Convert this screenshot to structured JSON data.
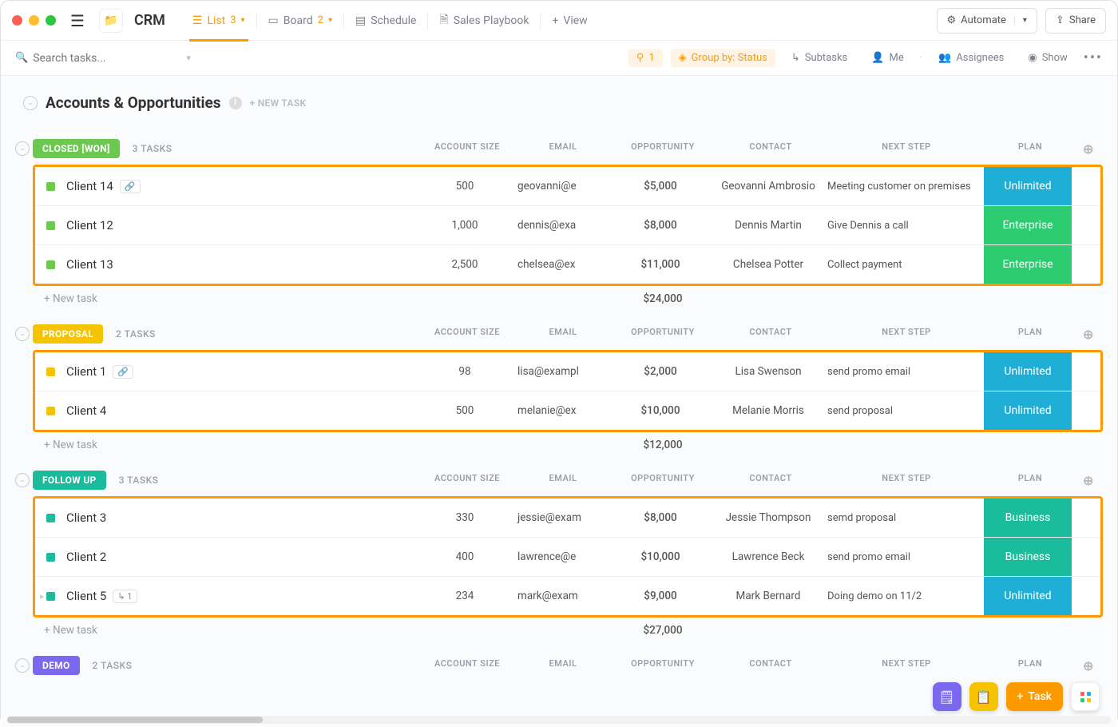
{
  "app": {
    "title": "CRM"
  },
  "views": {
    "list": {
      "label": "List",
      "count": "3"
    },
    "board": {
      "label": "Board",
      "count": "2"
    },
    "schedule": {
      "label": "Schedule"
    },
    "playbook": {
      "label": "Sales Playbook"
    },
    "add": {
      "label": "View"
    }
  },
  "topbar": {
    "automate": "Automate",
    "share": "Share"
  },
  "filters": {
    "search_placeholder": "Search tasks...",
    "filter_count": "1",
    "group_by": "Group by: Status",
    "subtasks": "Subtasks",
    "me": "Me",
    "assignees": "Assignees",
    "show": "Show"
  },
  "list": {
    "title": "Accounts & Opportunities",
    "new_task_header": "+ NEW TASK",
    "new_task_row": "+ New task",
    "columns": {
      "account_size": "ACCOUNT SIZE",
      "email": "EMAIL",
      "opportunity": "OPPORTUNITY",
      "contact": "CONTACT",
      "next_step": "NEXT STEP",
      "plan": "PLAN"
    }
  },
  "groups": [
    {
      "id": "closed-won",
      "label": "CLOSED [WON]",
      "pill_class": "pill-green",
      "sq_class": "sq-green",
      "task_count": "3 TASKS",
      "sum": "$24,000",
      "rows": [
        {
          "name": "Client 14",
          "link": true,
          "acct": "500",
          "email": "geovanni@e",
          "opp": "$5,000",
          "contact": "Geovanni Ambrosio",
          "next": "Meeting customer on premises",
          "plan": "Unlimited",
          "plan_class": "plan-unlimited"
        },
        {
          "name": "Client 12",
          "acct": "1,000",
          "email": "dennis@exa",
          "opp": "$8,000",
          "contact": "Dennis Martin",
          "next": "Give Dennis a call",
          "plan": "Enterprise",
          "plan_class": "plan-enterprise"
        },
        {
          "name": "Client 13",
          "acct": "2,500",
          "email": "chelsea@ex",
          "opp": "$11,000",
          "contact": "Chelsea Potter",
          "next": "Collect payment",
          "plan": "Enterprise",
          "plan_class": "plan-enterprise"
        }
      ]
    },
    {
      "id": "proposal",
      "label": "PROPOSAL",
      "pill_class": "pill-yellow",
      "sq_class": "sq-yellow",
      "task_count": "2 TASKS",
      "sum": "$12,000",
      "rows": [
        {
          "name": "Client 1",
          "link": true,
          "acct": "98",
          "email": "lisa@exampl",
          "opp": "$2,000",
          "contact": "Lisa Swenson",
          "next": "send promo email",
          "plan": "Unlimited",
          "plan_class": "plan-unlimited"
        },
        {
          "name": "Client 4",
          "acct": "500",
          "email": "melanie@ex",
          "opp": "$10,000",
          "contact": "Melanie Morris",
          "next": "send proposal",
          "plan": "Unlimited",
          "plan_class": "plan-unlimited"
        }
      ]
    },
    {
      "id": "follow-up",
      "label": "FOLLOW UP",
      "pill_class": "pill-teal",
      "sq_class": "sq-teal",
      "task_count": "3 TASKS",
      "sum": "$27,000",
      "rows": [
        {
          "name": "Client 3",
          "acct": "330",
          "email": "jessie@exam",
          "opp": "$8,000",
          "contact": "Jessie Thompson",
          "next": "semd proposal",
          "plan": "Business",
          "plan_class": "plan-business"
        },
        {
          "name": "Client 2",
          "acct": "400",
          "email": "lawrence@e",
          "opp": "$10,000",
          "contact": "Lawrence Beck",
          "next": "send promo email",
          "plan": "Business",
          "plan_class": "plan-business"
        },
        {
          "name": "Client 5",
          "sub": "1",
          "acct": "234",
          "email": "mark@exam",
          "opp": "$9,000",
          "contact": "Mark Bernard",
          "next": "Doing demo on 11/2",
          "plan": "Unlimited",
          "plan_class": "plan-unlimited",
          "arrow": true
        }
      ]
    },
    {
      "id": "demo",
      "label": "DEMO",
      "pill_class": "pill-purple",
      "sq_class": "",
      "task_count": "2 TASKS",
      "sum": "",
      "rows": []
    }
  ],
  "fab": {
    "task": "Task"
  }
}
